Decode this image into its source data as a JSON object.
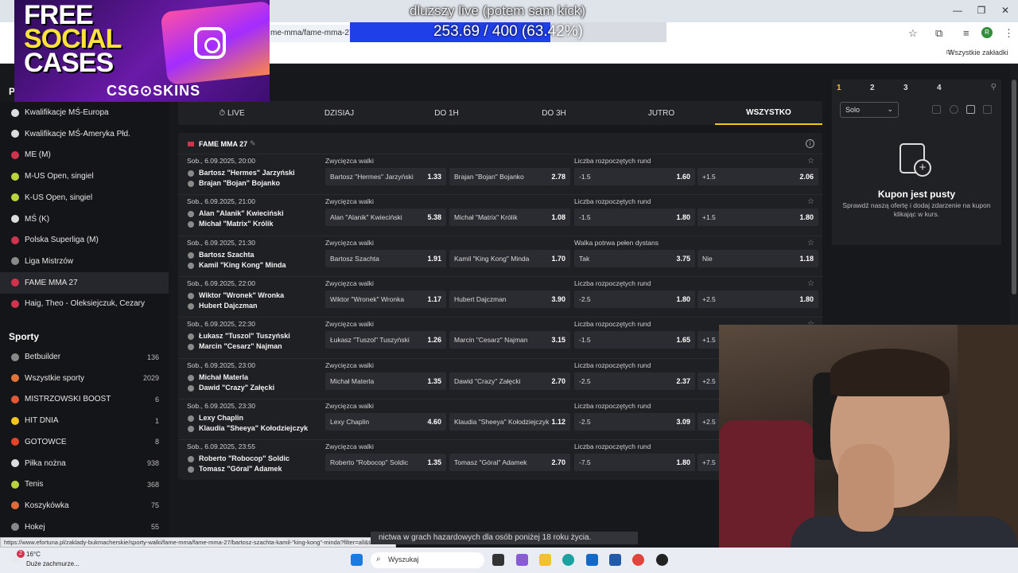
{
  "browser": {
    "url": "me-mma/fame-mma-27",
    "bookmarks_label": "Wszystkie zakładki",
    "profile_initial": "R"
  },
  "ad": {
    "line1": "FREE",
    "line2": "SOCIAL",
    "line3": "CASES",
    "brand": "CSG⊙SKINS"
  },
  "stream": {
    "title": "dluzszy live (potem sam kick)",
    "goal_text": "253.69 / 400 (63.42%)",
    "goal_fraction": 0.6342
  },
  "sidebar": {
    "p_head": "P",
    "items": [
      {
        "label": "Kwalifikacje MŚ-Europa",
        "color": "#dddddd"
      },
      {
        "label": "Kwalifikacje MŚ-Ameryka Płd.",
        "color": "#dddddd"
      },
      {
        "label": "ME (M)",
        "color": "#d0334c"
      },
      {
        "label": "M-US Open, singiel",
        "color": "#b8d43a"
      },
      {
        "label": "K-US Open, singiel",
        "color": "#b8d43a"
      },
      {
        "label": "MŚ (K)",
        "color": "#dddddd"
      },
      {
        "label": "Polska Superliga (M)",
        "color": "#d0334c"
      },
      {
        "label": "Liga Mistrzów",
        "color": "#8a8a8a"
      },
      {
        "label": "FAME MMA 27",
        "color": "#d0334c"
      },
      {
        "label": "Haig, Theo - Oleksiejczuk, Cezary",
        "color": "#d0334c"
      }
    ],
    "sports_head": "Sporty",
    "sports": [
      {
        "label": "Betbuilder",
        "count": "136",
        "color": "#888"
      },
      {
        "label": "Wszystkie sporty",
        "count": "2029",
        "color": "#e0743a"
      },
      {
        "label": "MISTRZOWSKI BOOST",
        "count": "6",
        "color": "#e05a3a"
      },
      {
        "label": "HIT DNIA",
        "count": "1",
        "color": "#f4c51c"
      },
      {
        "label": "GOTOWCE",
        "count": "8",
        "color": "#e8422a"
      },
      {
        "label": "Piłka nożna",
        "count": "938",
        "color": "#dddddd"
      },
      {
        "label": "Tenis",
        "count": "368",
        "color": "#b8d43a"
      },
      {
        "label": "Koszykówka",
        "count": "75",
        "color": "#e06a3a"
      },
      {
        "label": "Hokej",
        "count": "55",
        "color": "#888"
      }
    ]
  },
  "tabs": [
    "⏱ LIVE",
    "DZISIAJ",
    "DO 1H",
    "DO 3H",
    "JUTRO",
    "WSZYSTKO"
  ],
  "league": "FAME MMA 27",
  "events": [
    {
      "date": "Sob., 6.09.2025, 20:00",
      "p1": "Bartosz \"Hermes\" Jarzyński",
      "p2": "Brajan \"Bojan\" Bojanko",
      "m1": "Zwycięzca walki",
      "o1n": "Bartosz \"Hermes\" Jarzyński",
      "o1v": "1.33",
      "o2n": "Brajan \"Bojan\" Bojanko",
      "o2v": "2.78",
      "m2": "Liczba rozpoczętych rund",
      "o3n": "-1.5",
      "o3v": "1.60",
      "o4n": "+1.5",
      "o4v": "2.06"
    },
    {
      "date": "Sob., 6.09.2025, 21:00",
      "p1": "Alan \"Alanik\" Kwieciński",
      "p2": "Michał \"Matrix\" Królik",
      "m1": "Zwycięzca walki",
      "o1n": "Alan \"Alanik\" Kwieciński",
      "o1v": "5.38",
      "o2n": "Michał \"Matrix\" Królik",
      "o2v": "1.08",
      "m2": "Liczba rozpoczętych rund",
      "o3n": "-1.5",
      "o3v": "1.80",
      "o4n": "+1.5",
      "o4v": "1.80"
    },
    {
      "date": "Sob., 6.09.2025, 21:30",
      "p1": "Bartosz Szachta",
      "p2": "Kamil \"King Kong\" Minda",
      "m1": "Zwycięzca walki",
      "o1n": "Bartosz Szachta",
      "o1v": "1.91",
      "o2n": "Kamil \"King Kong\" Minda",
      "o2v": "1.70",
      "m2": "Walka potrwa pełen dystans",
      "o3n": "Tak",
      "o3v": "3.75",
      "o4n": "Nie",
      "o4v": "1.18"
    },
    {
      "date": "Sob., 6.09.2025, 22:00",
      "p1": "Wiktor \"Wronek\" Wronka",
      "p2": "Hubert Dajczman",
      "m1": "Zwycięzca walki",
      "o1n": "Wiktor \"Wronek\" Wronka",
      "o1v": "1.17",
      "o2n": "Hubert Dajczman",
      "o2v": "3.90",
      "m2": "Liczba rozpoczętych rund",
      "o3n": "-2.5",
      "o3v": "1.80",
      "o4n": "+2.5",
      "o4v": "1.80"
    },
    {
      "date": "Sob., 6.09.2025, 22:30",
      "p1": "Łukasz \"Tuszol\" Tuszyński",
      "p2": "Marcin \"Cesarz\" Najman",
      "m1": "Zwycięzca walki",
      "o1n": "Łukasz \"Tuszol\" Tuszyński",
      "o1v": "1.26",
      "o2n": "Marcin \"Cesarz\" Najman",
      "o2v": "3.15",
      "m2": "Liczba rozpoczętych rund",
      "o3n": "-1.5",
      "o3v": "1.65",
      "o4n": "+1.5",
      "o4v": ""
    },
    {
      "date": "Sob., 6.09.2025, 23:00",
      "p1": "Michał Materla",
      "p2": "Dawid \"Crazy\" Załęcki",
      "m1": "Zwycięzca walki",
      "o1n": "Michał Materla",
      "o1v": "1.35",
      "o2n": "Dawid \"Crazy\" Załęcki",
      "o2v": "2.70",
      "m2": "Liczba rozpoczętych rund",
      "o3n": "-2.5",
      "o3v": "2.37",
      "o4n": "+2.5",
      "o4v": ""
    },
    {
      "date": "Sob., 6.09.2025, 23:30",
      "p1": "Lexy Chaplin",
      "p2": "Klaudia \"Sheeya\" Kołodziejczyk",
      "m1": "Zwycięzca walki",
      "o1n": "Lexy Chaplin",
      "o1v": "4.60",
      "o2n": "Klaudia \"Sheeya\" Kołodziejczyk",
      "o2v": "1.12",
      "m2": "Liczba rozpoczętych rund",
      "o3n": "-2.5",
      "o3v": "3.09",
      "o4n": "+2.5",
      "o4v": ""
    },
    {
      "date": "Sob., 6.09.2025, 23:55",
      "p1": "Roberto \"Robocop\" Soldic",
      "p2": "Tomasz \"Góral\" Adamek",
      "m1": "Zwycięzca walki",
      "o1n": "Roberto \"Robocop\" Soldic",
      "o1v": "1.35",
      "o2n": "Tomasz \"Góral\" Adamek",
      "o2v": "2.70",
      "m2": "Liczba rozpoczętych rund",
      "o3n": "-7.5",
      "o3v": "1.80",
      "o4n": "+7.5",
      "o4v": ""
    }
  ],
  "coupon": {
    "tabs": [
      "1",
      "2",
      "3",
      "4"
    ],
    "mode": "Solo",
    "title": "Kupon jest pusty",
    "subtitle": "Sprawdź naszą ofertę i dodaj zdarzenie na kupon klikając w kurs."
  },
  "status_url": "https://www.efortuna.pl/zaklady-bukmacherskie/sporty-walki/fame-mma/fame-mma-27/bartosz-szachta-kamil-\"king-kong\"-minda?filter=all&tab=offer",
  "responsible": "nictwa w grach hazardowych dla osób poniżej 18 roku życia.",
  "taskbar": {
    "temp": "16°C",
    "weather": "Duże zachmurze...",
    "search": "Wyszukaj",
    "badge": "2"
  }
}
